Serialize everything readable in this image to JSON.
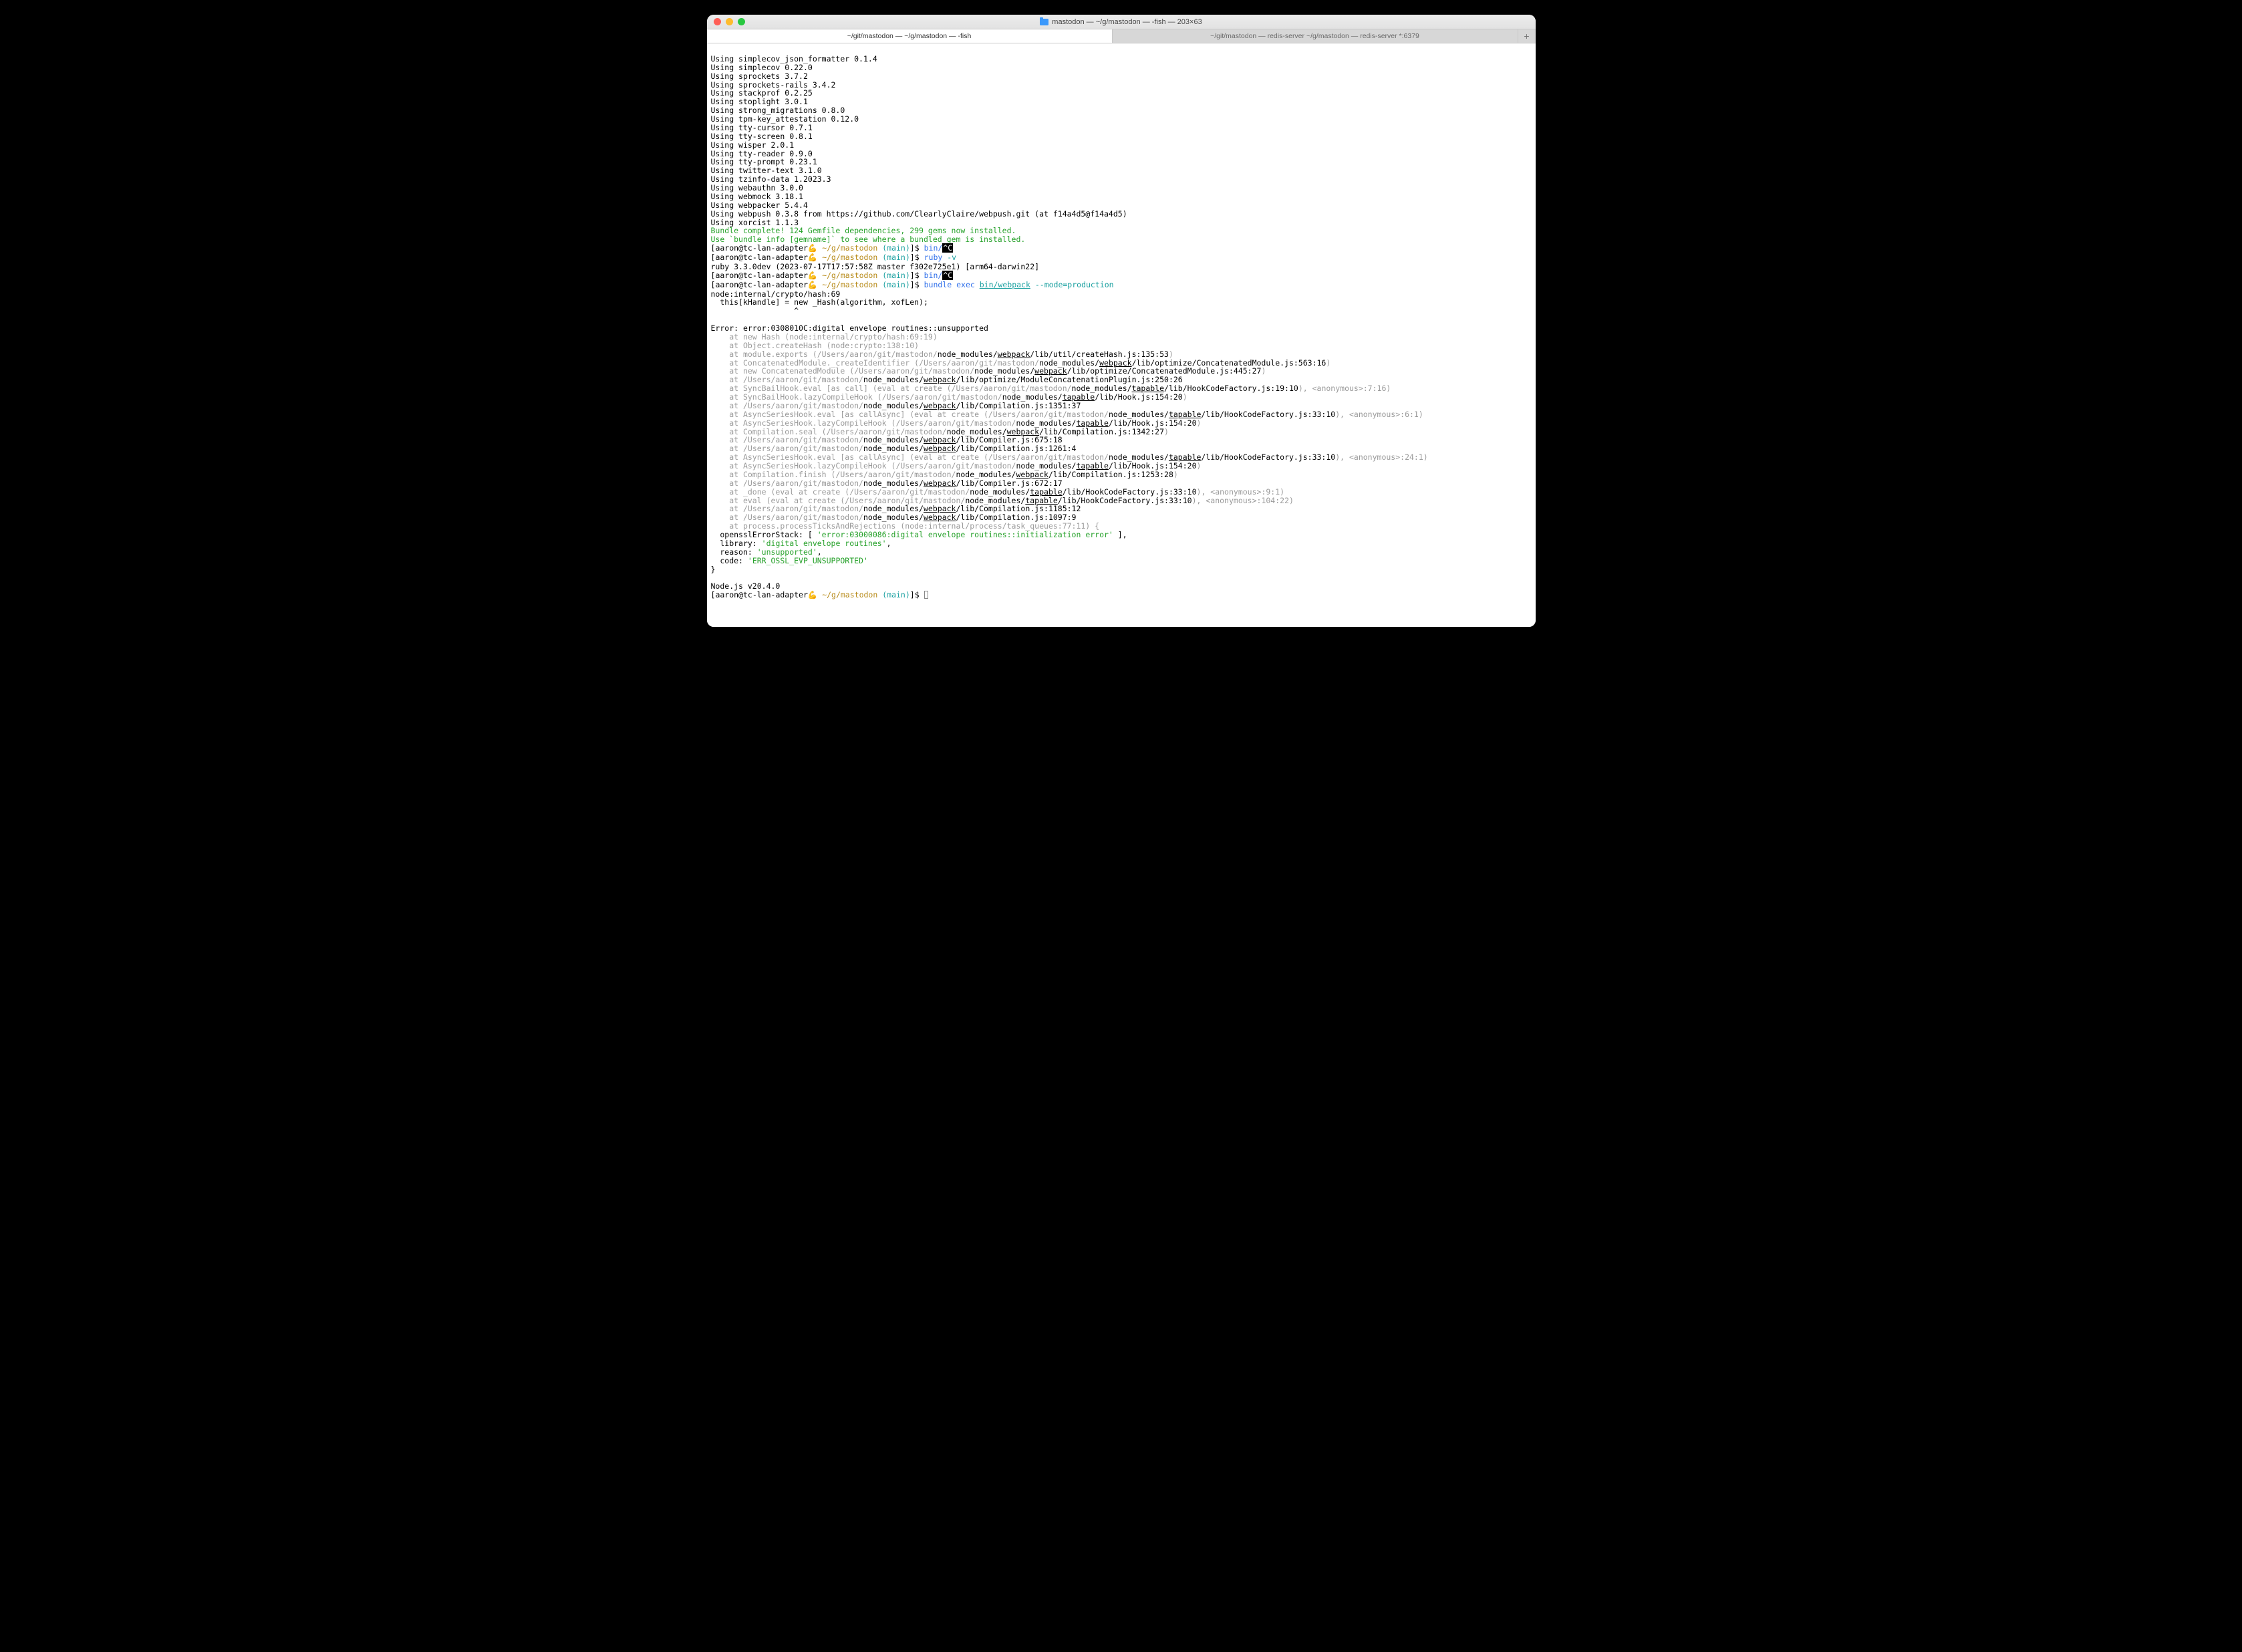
{
  "window": {
    "title": "mastodon — ~/g/mastodon — -fish — 203×63"
  },
  "tabs": [
    {
      "label": "~/git/mastodon — ~/g/mastodon — -fish",
      "active": true
    },
    {
      "label": "~/git/mastodon — redis-server ~/g/mastodon — redis-server *:6379",
      "active": false
    }
  ],
  "using": [
    "Using simplecov_json_formatter 0.1.4",
    "Using simplecov 0.22.0",
    "Using sprockets 3.7.2",
    "Using sprockets-rails 3.4.2",
    "Using stackprof 0.2.25",
    "Using stoplight 3.0.1",
    "Using strong_migrations 0.8.0",
    "Using tpm-key_attestation 0.12.0",
    "Using tty-cursor 0.7.1",
    "Using tty-screen 0.8.1",
    "Using wisper 2.0.1",
    "Using tty-reader 0.9.0",
    "Using tty-prompt 0.23.1",
    "Using twitter-text 3.1.0",
    "Using tzinfo-data 1.2023.3",
    "Using webauthn 3.0.0",
    "Using webmock 3.18.1",
    "Using webpacker 5.4.4",
    "Using webpush 0.3.8 from https://github.com/ClearlyClaire/webpush.git (at f14a4d5@f14a4d5)",
    "Using xorcist 1.1.3"
  ],
  "bundle1": "Bundle complete! 124 Gemfile dependencies, 299 gems now installed.",
  "bundle2": "Use `bundle info [gemname]` to see where a bundled gem is installed.",
  "prompt": {
    "user": "aaron@tc-lan-adapter",
    "path": "~/g/mastodon",
    "branch": "main",
    "emoji": "💪",
    "dollar": "$"
  },
  "cmd_bin": "bin/",
  "ctrl_c": "^C",
  "cmd_ruby": "ruby",
  "ruby_flag": "-v",
  "ruby_ver": "ruby 3.3.0dev (2023-07-17T17:57:58Z master f302e725e1) [arm64-darwin22]",
  "cmd_bundle": "bundle",
  "cmd_exec": "exec",
  "cmd_binwebpack": "bin/webpack",
  "cmd_mode": "--mode=production",
  "node_hdr": "node:internal/crypto/hash:69",
  "node_line": "  this[kHandle] = new _Hash(algorithm, xofLen);",
  "node_caret": "                  ^",
  "err_head": "Error: error:0308010C:digital envelope routines::unsupported",
  "trace": {
    "t01a": "    at new Hash (node:internal/crypto/hash:69:19)",
    "t02a": "    at Object.createHash (node:crypto:138:10)",
    "t03a": "    at module.exports (",
    "t03b": "/Users/aaron/git/mastodon/",
    "t03c": "node_modules/",
    "t03d": "webpack",
    "t03e": "/lib/util/createHash.js:135:53",
    "t04a": "    at ConcatenatedModule._createIdentifier (",
    "t04b": "/Users/aaron/git/mastodon/",
    "t04c": "node_modules/",
    "t04d": "webpack",
    "t04e": "/lib/optimize/ConcatenatedModule.js:563:16",
    "t05a": "    at new ConcatenatedModule (",
    "t05b": "/Users/aaron/git/mastodon/",
    "t05c": "node_modules/",
    "t05d": "webpack",
    "t05e": "/lib/optimize/ConcatenatedModule.js:445:27",
    "t06a": "    at ",
    "t06b": "/Users/aaron/git/mastodon/",
    "t06c": "node_modules/",
    "t06d": "webpack",
    "t06e": "/lib/optimize/ModuleConcatenationPlugin.js:250:26",
    "t07a": "    at SyncBailHook.eval [as call] (eval at create (",
    "t07b": "/Users/aaron/git/mastodon/",
    "t07c": "node_modules/",
    "t07d": "tapable",
    "t07e": "/lib/HookCodeFactory.js:19:10",
    "t07f": "), <anonymous>:7:16)",
    "t08a": "    at SyncBailHook.lazyCompileHook (",
    "t08b": "/Users/aaron/git/mastodon/",
    "t08c": "node_modules/",
    "t08d": "tapable",
    "t08e": "/lib/Hook.js:154:20",
    "t09a": "    at ",
    "t09b": "/Users/aaron/git/mastodon/",
    "t09c": "node_modules/",
    "t09d": "webpack",
    "t09e": "/lib/Compilation.js:1351:37",
    "t10a": "    at AsyncSeriesHook.eval [as callAsync] (eval at create (",
    "t10b": "/Users/aaron/git/mastodon/",
    "t10c": "node_modules/",
    "t10d": "tapable",
    "t10e": "/lib/HookCodeFactory.js:33:10",
    "t10f": "), <anonymous>:6:1)",
    "t11a": "    at AsyncSeriesHook.lazyCompileHook (",
    "t11b": "/Users/aaron/git/mastodon/",
    "t11c": "node_modules/",
    "t11d": "tapable",
    "t11e": "/lib/Hook.js:154:20",
    "t12a": "    at Compilation.seal (",
    "t12b": "/Users/aaron/git/mastodon/",
    "t12c": "node_modules/",
    "t12d": "webpack",
    "t12e": "/lib/Compilation.js:1342:27",
    "t13a": "    at ",
    "t13b": "/Users/aaron/git/mastodon/",
    "t13c": "node_modules/",
    "t13d": "webpack",
    "t13e": "/lib/Compiler.js:675:18",
    "t14a": "    at ",
    "t14b": "/Users/aaron/git/mastodon/",
    "t14c": "node_modules/",
    "t14d": "webpack",
    "t14e": "/lib/Compilation.js:1261:4",
    "t15a": "    at AsyncSeriesHook.eval [as callAsync] (eval at create (",
    "t15b": "/Users/aaron/git/mastodon/",
    "t15c": "node_modules/",
    "t15d": "tapable",
    "t15e": "/lib/HookCodeFactory.js:33:10",
    "t15f": "), <anonymous>:24:1)",
    "t16a": "    at AsyncSeriesHook.lazyCompileHook (",
    "t16b": "/Users/aaron/git/mastodon/",
    "t16c": "node_modules/",
    "t16d": "tapable",
    "t16e": "/lib/Hook.js:154:20",
    "t17a": "    at Compilation.finish (",
    "t17b": "/Users/aaron/git/mastodon/",
    "t17c": "node_modules/",
    "t17d": "webpack",
    "t17e": "/lib/Compilation.js:1253:28",
    "t18a": "    at ",
    "t18b": "/Users/aaron/git/mastodon/",
    "t18c": "node_modules/",
    "t18d": "webpack",
    "t18e": "/lib/Compiler.js:672:17",
    "t19a": "    at _done (eval at create (",
    "t19b": "/Users/aaron/git/mastodon/",
    "t19c": "node_modules/",
    "t19d": "tapable",
    "t19e": "/lib/HookCodeFactory.js:33:10",
    "t19f": "), <anonymous>:9:1)",
    "t20a": "    at eval (eval at create (",
    "t20b": "/Users/aaron/git/mastodon/",
    "t20c": "node_modules/",
    "t20d": "tapable",
    "t20e": "/lib/HookCodeFactory.js:33:10",
    "t20f": "), <anonymous>:104:22)",
    "t21a": "    at ",
    "t21b": "/Users/aaron/git/mastodon/",
    "t21c": "node_modules/",
    "t21d": "webpack",
    "t21e": "/lib/Compilation.js:1185:12",
    "t22a": "    at ",
    "t22b": "/Users/aaron/git/mastodon/",
    "t22c": "node_modules/",
    "t22d": "webpack",
    "t22e": "/lib/Compilation.js:1097:9",
    "t23a": "    at process.processTicksAndRejections (node:internal/process/task_queues:77:11) {"
  },
  "ossl_lbl": "  opensslErrorStack: [ ",
  "ossl_val": "'error:03000086:digital envelope routines::initialization error'",
  "ossl_end": " ],",
  "lib_lbl": "  library: ",
  "lib_val": "'digital envelope routines'",
  "reason_lbl": "  reason: ",
  "reason_val": "'unsupported'",
  "code_lbl": "  code: ",
  "code_val": "'ERR_OSSL_EVP_UNSUPPORTED'",
  "brace": "}",
  "comma": ",",
  "paren": ")",
  "node_ver": "Node.js v20.4.0"
}
